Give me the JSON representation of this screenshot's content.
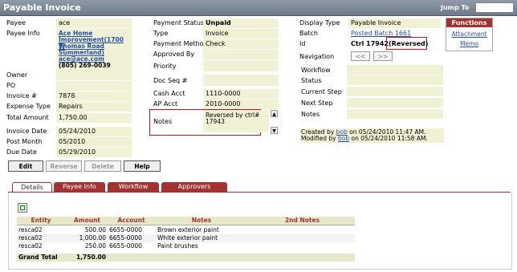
{
  "window": {
    "title": "Payable Invoice",
    "jump_to_label": "Jump To",
    "jump_to_value": ""
  },
  "left": {
    "payee_label": "Payee",
    "payee_value": "ace",
    "payee_info_label": "Payee Info",
    "payee_info_lines": [
      "Ace Home",
      "Improvement(1700 W",
      "Thomas Road",
      "Summerland)",
      "ace@ace.com",
      "(805) 269-0039"
    ],
    "owner_label": "Owner",
    "owner_value": "",
    "po_label": "PO",
    "po_value": "",
    "invoice_label": "Invoice #",
    "invoice_value": "7878",
    "expense_type_label": "Expense Type",
    "expense_type_value": "Repairs",
    "total_amount_label": "Total Amount",
    "total_amount_value": "1,750.00",
    "invoice_date_label": "Invoice Date",
    "invoice_date_value": "05/24/2010",
    "post_month_label": "Post Month",
    "post_month_value": "05/2010",
    "due_date_label": "Due Date",
    "due_date_value": "05/29/2010"
  },
  "middle": {
    "payment_status_label": "Payment Status",
    "payment_status_value": "Unpaid",
    "type_label": "Type",
    "type_value": "Invoice",
    "payment_method_label": "Payment Method",
    "payment_method_value": "Check",
    "approved_by_label": "Approved By",
    "approved_by_value": "",
    "priority_label": "Priority",
    "priority_value": "",
    "doc_seq_label": "Doc Seq #",
    "doc_seq_value": "",
    "cash_acct_label": "Cash Acct",
    "cash_acct_value": "1110-0000",
    "ap_acct_label": "AP Acct",
    "ap_acct_value": "2010-0000",
    "notes_label": "Notes",
    "notes_line1": "Reversed by ctrl#",
    "notes_line2": "17943"
  },
  "right": {
    "display_type_label": "Display Type",
    "display_type_value": "Payable Invoice",
    "batch_label": "Batch",
    "batch_value": "Posted Batch 1661",
    "id_label": "Id",
    "id_value": "Ctrl 17942",
    "id_status": "(Reversed)",
    "navigation_label": "Navigation",
    "nav_prev": "<<",
    "nav_next": ">>",
    "workflow_label": "Workflow",
    "status_label": "Status",
    "current_step_label": "Current Step",
    "next_step_label": "Next Step",
    "notes_label": "Notes",
    "created_by": "Created by",
    "created_by_user": "bob",
    "created_on": "on 05/24/2010 11:47 AM.",
    "modified_by": "Modified by",
    "modified_by_user": "bob",
    "modified_on": "on 05/24/2010 11:58 AM."
  },
  "functions": {
    "header": "Functions",
    "attachment": "Attachment",
    "memo": "Memo"
  },
  "buttons": {
    "edit": "Edit",
    "reverse": "Reverse",
    "delete": "Delete",
    "help": "Help"
  },
  "tabs": [
    "Details",
    "Payee Info",
    "Workflow",
    "Approvers"
  ],
  "grid": {
    "columns": [
      "Entity",
      "Amount",
      "Account",
      "Notes",
      "2nd Notes"
    ],
    "rows": [
      {
        "entity": "resca02",
        "amount": "500.00",
        "account": "6655-0000",
        "notes": "Brown exterior paint",
        "notes2": ""
      },
      {
        "entity": "resca02",
        "amount": "1,000.00",
        "account": "6655-0000",
        "notes": "White exterior paint",
        "notes2": ""
      },
      {
        "entity": "resca02",
        "amount": "250.00",
        "account": "6655-0000",
        "notes": "Paint brushes",
        "notes2": ""
      }
    ],
    "grand_total_label": "Grand Total",
    "grand_total_value": "1,750.00"
  },
  "colors": {
    "accent": "#a33333",
    "field_bg": "#f1f1d6",
    "link": "#2650a8",
    "highlight": "#c8141e"
  }
}
